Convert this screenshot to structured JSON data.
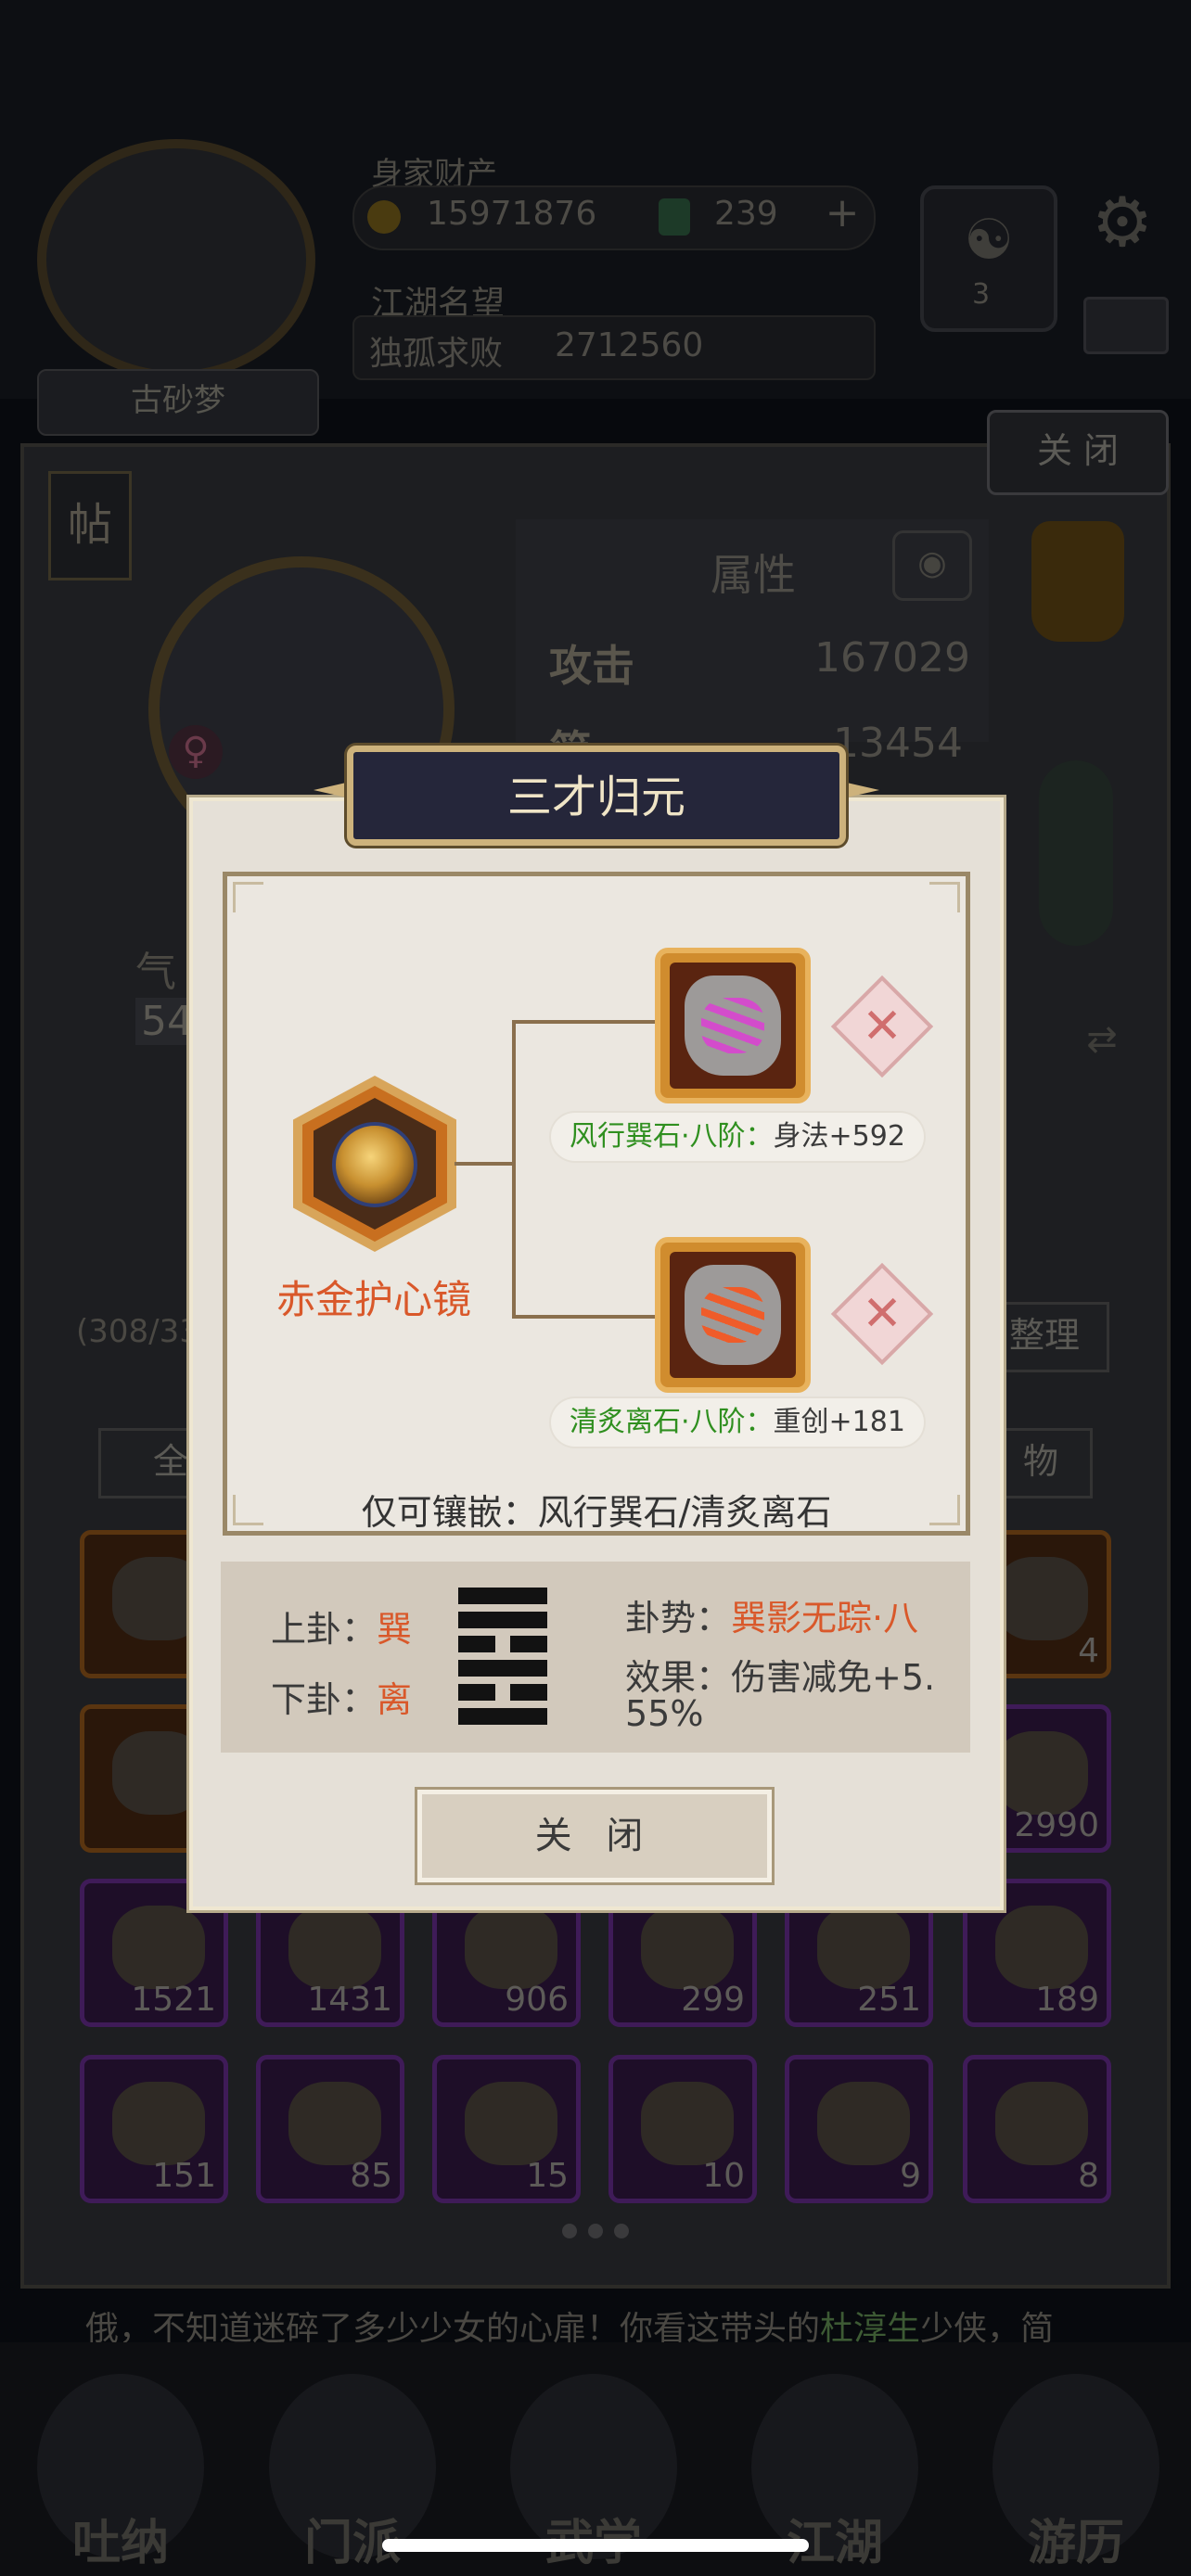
{
  "header": {
    "player_name": "古砂梦",
    "wealth_label": "身家财产",
    "money": "15971876",
    "jade": "239",
    "plus": "+",
    "fame_label": "江湖名望",
    "fame_title": "独孤求败",
    "fame_value": "2712560",
    "yinyang_symbol": "☯",
    "yinyang_level": "3",
    "settings_icon": "⚙"
  },
  "character": {
    "tie_button": "帖",
    "close_button": "关 闭",
    "gender_icon": "♀",
    "qi_label": "气",
    "qi_value": "54",
    "attr_title": "属性",
    "attack_label": "攻击",
    "attack_value": "167029",
    "defense_label": "简",
    "defense_value": "13454",
    "bag_count": "(308/33",
    "sort_button": "整理",
    "filter_all": "全",
    "filter_item": "物"
  },
  "inventory": [
    {
      "count": "4",
      "type": "orange"
    },
    {
      "count": "4",
      "type": "orange"
    },
    {
      "count": "",
      "type": "orange"
    },
    {
      "count": "2990",
      "type": "purple"
    },
    {
      "count": "1521",
      "type": "purple"
    },
    {
      "count": "1431",
      "type": "purple"
    },
    {
      "count": "906",
      "type": "purple"
    },
    {
      "count": "299",
      "type": "purple"
    },
    {
      "count": "251",
      "type": "purple"
    },
    {
      "count": "189",
      "type": "purple"
    },
    {
      "count": "151",
      "type": "purple"
    },
    {
      "count": "85",
      "type": "purple"
    },
    {
      "count": "15",
      "type": "purple"
    },
    {
      "count": "10",
      "type": "purple"
    },
    {
      "count": "9",
      "type": "purple"
    },
    {
      "count": "8",
      "type": "purple"
    }
  ],
  "ticker": {
    "text_before": "俄，不知道迷碎了多少少女的心扉！你看这带头的",
    "highlight": "杜淳生",
    "text_after": "少侠，简"
  },
  "bottom_nav": [
    "吐纳",
    "门派",
    "武学",
    "江湖",
    "游历"
  ],
  "modal": {
    "title": "三才归元",
    "equipment_name": "赤金护心镜",
    "gem1_name": "风行巽石·八阶：",
    "gem1_stat": "身法+592",
    "gem2_name": "清炙离石·八阶：",
    "gem2_stat": "重创+181",
    "remove_symbol": "✕",
    "restriction": "仅可镶嵌：风行巽石/清炙离石",
    "upper_label": "上卦：",
    "upper_value": "巽",
    "lower_label": "下卦：",
    "lower_value": "离",
    "trend_label": "卦势：",
    "trend_value": "巽影无踪·八",
    "effect_label": "效果：",
    "effect_value": "伤害减免+5.",
    "effect_value_2": "55%",
    "close_button": "关 闭"
  },
  "colors": {
    "accent_orange": "#d9582a",
    "gem_green": "#2f8f1f",
    "modal_bg": "#e5e0d7"
  }
}
